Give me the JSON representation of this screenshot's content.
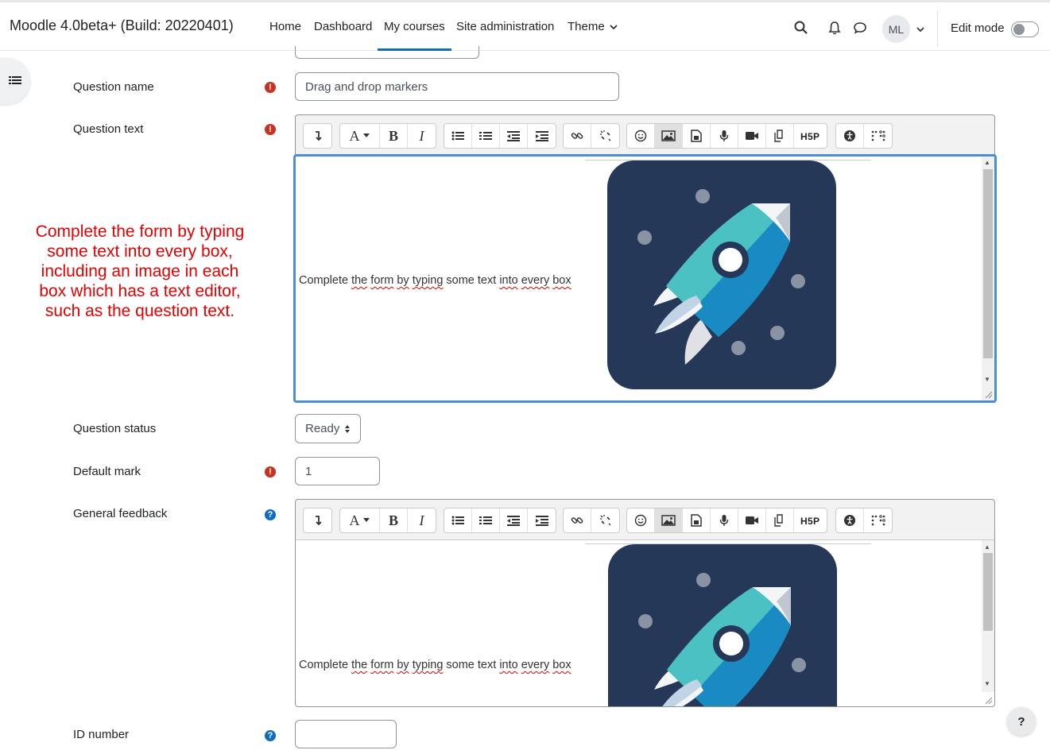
{
  "navbar": {
    "brand": "Moodle 4.0beta+ (Build: 20220401)",
    "items": [
      "Home",
      "Dashboard",
      "My courses",
      "Site administration",
      "Theme"
    ],
    "active_item": "My courses",
    "avatar_initials": "ML",
    "edit_mode_label": "Edit mode",
    "edit_mode_on": false
  },
  "form": {
    "question_name": {
      "label": "Question name",
      "value": "Drag and drop markers",
      "required": true
    },
    "question_text": {
      "label": "Question text",
      "required": true,
      "content": "Complete the form by typing some text into every box"
    },
    "question_status": {
      "label": "Question status",
      "selected": "Ready"
    },
    "default_mark": {
      "label": "Default mark",
      "value": "1",
      "required": true
    },
    "general_feedback": {
      "label": "General feedback",
      "content": "Complete the form by typing some text into every box"
    },
    "id_number": {
      "label": "ID number",
      "value": ""
    }
  },
  "annotation": "Complete the form by typing some text into every box, including an image in each box which has a text editor, such as the question text.",
  "icons": {
    "search": "search-icon",
    "notifications": "bell-icon",
    "messages": "chat-icon",
    "drawer": "list-icon",
    "required": "exclamation-icon",
    "help": "question-mark-icon"
  },
  "help_button": "?",
  "colors": {
    "brand_blue": "#0f6cbf",
    "required_red": "#ca3120",
    "annotation_red": "#e60000",
    "image_bg": "#253858"
  }
}
